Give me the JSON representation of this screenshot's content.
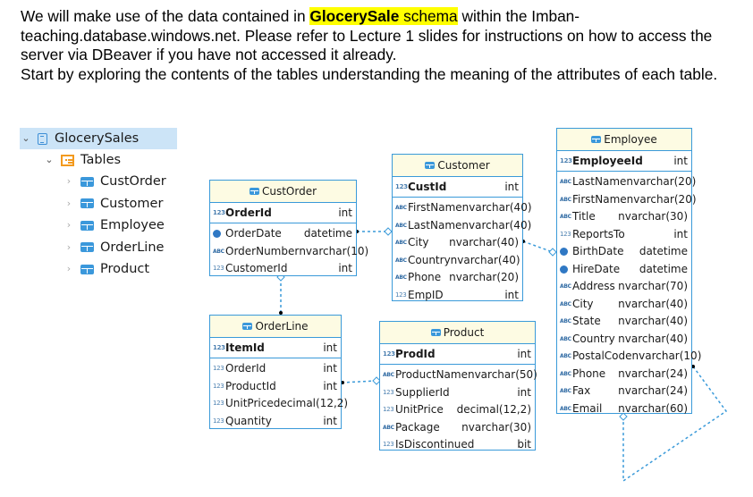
{
  "intro": {
    "part1": "We will make use of the data contained in ",
    "highlight_bold": "GlocerySale",
    "highlight_rest": " schema",
    "part2": " within the Imban-teaching.database.windows.net. Please refer to Lecture 1 slides for instructions on how to access the server via DBeaver if you have not accessed it already.",
    "line2": "Start by exploring the contents of the tables understanding the meaning of the attributes of each table.",
    "highlight_color": "#ffff00"
  },
  "navigator": {
    "schema": {
      "label": "GlocerySales",
      "icon": "database-icon",
      "expanded": true,
      "selected": true
    },
    "folder": {
      "label": "Tables",
      "icon": "tables-folder-icon",
      "expanded": true
    },
    "tables": [
      {
        "label": "CustOrder",
        "icon": "table-icon"
      },
      {
        "label": "Customer",
        "icon": "table-icon"
      },
      {
        "label": "Employee",
        "icon": "table-icon"
      },
      {
        "label": "OrderLine",
        "icon": "table-icon"
      },
      {
        "label": "Product",
        "icon": "table-icon"
      }
    ]
  },
  "er": {
    "accent_color": "#3a9ad9",
    "header_color": "#fdfbe3",
    "entities": {
      "custorder": {
        "title": "CustOrder",
        "pk": {
          "name": "OrderId",
          "type": "int",
          "icon": "123"
        },
        "columns": [
          {
            "name": "OrderDate",
            "type": "datetime",
            "icon": "clock"
          },
          {
            "name": "OrderNumber",
            "type": "nvarchar(10)",
            "icon": "abc"
          },
          {
            "name": "CustomerId",
            "type": "int",
            "icon": "123"
          }
        ]
      },
      "customer": {
        "title": "Customer",
        "pk": {
          "name": "CustId",
          "type": "int",
          "icon": "123"
        },
        "columns": [
          {
            "name": "FirstName",
            "type": "nvarchar(40)",
            "icon": "abc"
          },
          {
            "name": "LastName",
            "type": "nvarchar(40)",
            "icon": "abc"
          },
          {
            "name": "City",
            "type": "nvarchar(40)",
            "icon": "abc"
          },
          {
            "name": "Country",
            "type": "nvarchar(40)",
            "icon": "abc"
          },
          {
            "name": "Phone",
            "type": "nvarchar(20)",
            "icon": "abc"
          },
          {
            "name": "EmpID",
            "type": "int",
            "icon": "123"
          }
        ]
      },
      "employee": {
        "title": "Employee",
        "pk": {
          "name": "EmployeeId",
          "type": "int",
          "icon": "123"
        },
        "columns": [
          {
            "name": "LastName",
            "type": "nvarchar(20)",
            "icon": "abc"
          },
          {
            "name": "FirstName",
            "type": "nvarchar(20)",
            "icon": "abc"
          },
          {
            "name": "Title",
            "type": "nvarchar(30)",
            "icon": "abc"
          },
          {
            "name": "ReportsTo",
            "type": "int",
            "icon": "123"
          },
          {
            "name": "BirthDate",
            "type": "datetime",
            "icon": "clock"
          },
          {
            "name": "HireDate",
            "type": "datetime",
            "icon": "clock"
          },
          {
            "name": "Address",
            "type": "nvarchar(70)",
            "icon": "abc"
          },
          {
            "name": "City",
            "type": "nvarchar(40)",
            "icon": "abc"
          },
          {
            "name": "State",
            "type": "nvarchar(40)",
            "icon": "abc"
          },
          {
            "name": "Country",
            "type": "nvarchar(40)",
            "icon": "abc"
          },
          {
            "name": "PostalCode",
            "type": "nvarchar(10)",
            "icon": "abc"
          },
          {
            "name": "Phone",
            "type": "nvarchar(24)",
            "icon": "abc"
          },
          {
            "name": "Fax",
            "type": "nvarchar(24)",
            "icon": "abc"
          },
          {
            "name": "Email",
            "type": "nvarchar(60)",
            "icon": "abc"
          }
        ]
      },
      "orderline": {
        "title": "OrderLine",
        "pk": {
          "name": "ItemId",
          "type": "int",
          "icon": "123"
        },
        "columns": [
          {
            "name": "OrderId",
            "type": "int",
            "icon": "123"
          },
          {
            "name": "ProductId",
            "type": "int",
            "icon": "123"
          },
          {
            "name": "UnitPrice",
            "type": "decimal(12,2)",
            "icon": "123"
          },
          {
            "name": "Quantity",
            "type": "int",
            "icon": "123"
          }
        ]
      },
      "product": {
        "title": "Product",
        "pk": {
          "name": "ProdId",
          "type": "int",
          "icon": "123"
        },
        "columns": [
          {
            "name": "ProductName",
            "type": "nvarchar(50)",
            "icon": "abc"
          },
          {
            "name": "SupplierId",
            "type": "int",
            "icon": "123"
          },
          {
            "name": "UnitPrice",
            "type": "decimal(12,2)",
            "icon": "123"
          },
          {
            "name": "Package",
            "type": "nvarchar(30)",
            "icon": "abc"
          },
          {
            "name": "IsDiscontinued",
            "type": "bit",
            "icon": "123"
          }
        ]
      }
    },
    "relationships": [
      {
        "from": "CustOrder",
        "to": "Customer"
      },
      {
        "from": "OrderLine",
        "to": "CustOrder"
      },
      {
        "from": "OrderLine",
        "to": "Product"
      },
      {
        "from": "Customer",
        "to": "Employee"
      },
      {
        "from": "Employee",
        "to": "Employee"
      }
    ]
  }
}
